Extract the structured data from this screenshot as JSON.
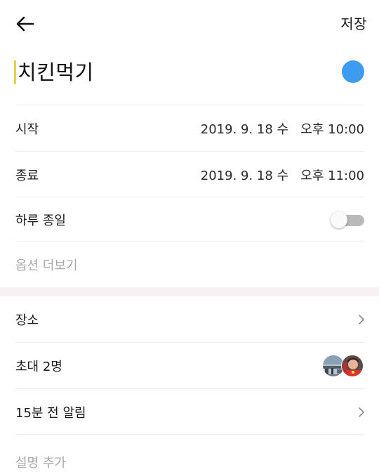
{
  "header": {
    "back_icon": "arrow-left-icon",
    "save_label": "저장"
  },
  "event": {
    "title": "치킨먹기",
    "color": "#3d9cf0"
  },
  "schedule": {
    "start_label": "시작",
    "start_value": "2019. 9. 18 수   오후 10:00",
    "end_label": "종료",
    "end_value": "2019. 9. 18 수   오후 11:00",
    "all_day_label": "하루 종일",
    "all_day_on": false,
    "more_options_label": "옵션 더보기"
  },
  "details": {
    "place_label": "장소",
    "invite_label": "초대 2명",
    "reminder_label": "15분 전 알림",
    "description_placeholder": "설명 추가"
  },
  "colors": {
    "accent_blue": "#3d9cf0",
    "cursor_yellow": "#e7d44a",
    "section_gap": "#f7f1f3",
    "muted_text": "#a8a8a8"
  }
}
